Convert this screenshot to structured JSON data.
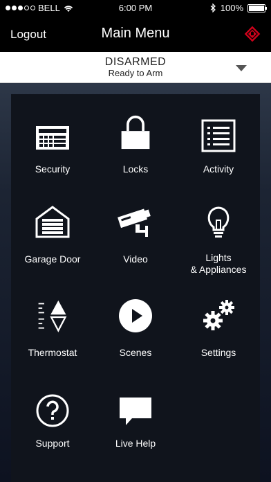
{
  "status": {
    "carrier": "BELL",
    "time": "6:00 PM",
    "battery": "100%",
    "battery_level": 1.0,
    "signal_bars_filled": 3,
    "signal_bars_total": 5
  },
  "nav": {
    "logout_label": "Logout",
    "title": "Main Menu",
    "brand_icon": "shield-brand-icon",
    "brand_color": "#d0021b"
  },
  "arm_state": {
    "state": "DISARMED",
    "sub": "Ready to Arm"
  },
  "menu": {
    "items": [
      {
        "label": "Security",
        "icon": "keypad-icon"
      },
      {
        "label": "Locks",
        "icon": "lock-icon"
      },
      {
        "label": "Activity",
        "icon": "list-icon"
      },
      {
        "label": "Garage Door",
        "icon": "garage-icon"
      },
      {
        "label": "Video",
        "icon": "camera-icon"
      },
      {
        "label": "Lights",
        "label2": "& Appliances",
        "icon": "bulb-icon"
      },
      {
        "label": "Thermostat",
        "icon": "thermostat-icon"
      },
      {
        "label": "Scenes",
        "icon": "play-icon"
      },
      {
        "label": "Settings",
        "icon": "gears-icon"
      },
      {
        "label": "Support",
        "icon": "question-icon"
      },
      {
        "label": "Live Help",
        "icon": "chat-icon"
      }
    ]
  }
}
